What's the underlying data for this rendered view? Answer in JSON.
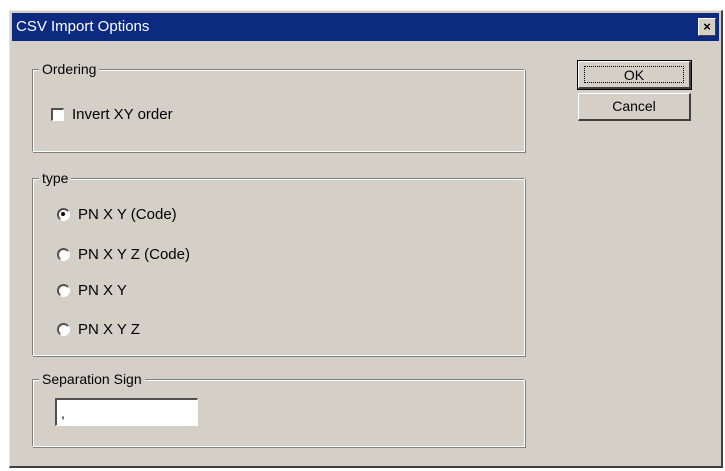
{
  "window": {
    "title": "CSV Import Options",
    "close_glyph": "×"
  },
  "ordering": {
    "label": "Ordering",
    "invert_xy_label": "Invert XY order",
    "invert_xy_checked": false
  },
  "type": {
    "label": "type",
    "options": [
      {
        "label": "PN X Y (Code)",
        "selected": true
      },
      {
        "label": "PN X Y Z (Code)",
        "selected": false
      },
      {
        "label": "PN X Y",
        "selected": false
      },
      {
        "label": "PN X Y Z",
        "selected": false
      }
    ]
  },
  "separation": {
    "label": "Separation Sign",
    "value": ","
  },
  "buttons": {
    "ok_label": "OK",
    "cancel_label": "Cancel"
  },
  "colors": {
    "titlebar": "#0b2a80",
    "face": "#d4d0c8"
  }
}
